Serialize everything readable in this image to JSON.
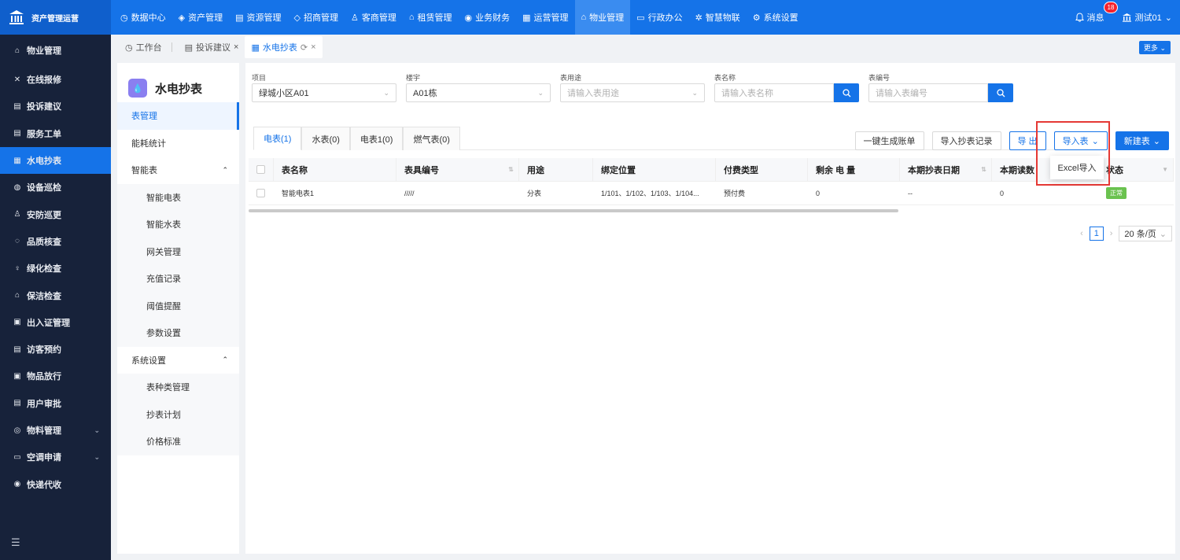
{
  "brand": {
    "name": "资产管理运营"
  },
  "topnav": [
    {
      "icon": "◷",
      "label": "数据中心"
    },
    {
      "icon": "◈",
      "label": "资产管理"
    },
    {
      "icon": "▤",
      "label": "资源管理"
    },
    {
      "icon": "◇",
      "label": "招商管理"
    },
    {
      "icon": "♙",
      "label": "客商管理"
    },
    {
      "icon": "⌂",
      "label": "租赁管理"
    },
    {
      "icon": "◉",
      "label": "业务财务"
    },
    {
      "icon": "▦",
      "label": "运营管理"
    },
    {
      "icon": "⌂",
      "label": "物业管理"
    },
    {
      "icon": "▭",
      "label": "行政办公"
    },
    {
      "icon": "✲",
      "label": "智慧物联"
    },
    {
      "icon": "⚙",
      "label": "系统设置"
    }
  ],
  "header": {
    "messages_label": "消息",
    "messages_count": "18",
    "user_name": "测试01"
  },
  "sidebar": {
    "items": [
      {
        "icon": "⌂",
        "label": "物业管理"
      },
      {
        "icon": "✕",
        "label": "在线报修"
      },
      {
        "icon": "▤",
        "label": "投诉建议"
      },
      {
        "icon": "▤",
        "label": "服务工单"
      },
      {
        "icon": "▦",
        "label": "水电抄表"
      },
      {
        "icon": "◍",
        "label": "设备巡检"
      },
      {
        "icon": "♙",
        "label": "安防巡更"
      },
      {
        "icon": "◌",
        "label": "品质核查"
      },
      {
        "icon": "♀",
        "label": "绿化检查"
      },
      {
        "icon": "⌂",
        "label": "保洁检查"
      },
      {
        "icon": "▣",
        "label": "出入证管理"
      },
      {
        "icon": "▤",
        "label": "访客预约"
      },
      {
        "icon": "▣",
        "label": "物品放行"
      },
      {
        "icon": "▤",
        "label": "用户审批"
      },
      {
        "icon": "◎",
        "label": "物料管理"
      },
      {
        "icon": "▭",
        "label": "空调申请"
      },
      {
        "icon": "◉",
        "label": "快递代收"
      }
    ],
    "collapse_icon": "☰"
  },
  "tabs": {
    "items": [
      {
        "icon": "◷",
        "label": "工作台"
      },
      {
        "icon": "▤",
        "label": "投诉建议",
        "close": "×"
      },
      {
        "icon": "▦",
        "label": "水电抄表",
        "refresh": "⟳",
        "close": "×"
      }
    ],
    "more": "更多"
  },
  "submenu": {
    "title": "水电抄表",
    "items": [
      {
        "label": "表管理"
      },
      {
        "label": "能耗统计"
      },
      {
        "label": "智能表"
      },
      {
        "label": "智能电表"
      },
      {
        "label": "智能水表"
      },
      {
        "label": "网关管理"
      },
      {
        "label": "充值记录"
      },
      {
        "label": "阈值提醒"
      },
      {
        "label": "参数设置"
      },
      {
        "label": "系统设置"
      },
      {
        "label": "表种类管理"
      },
      {
        "label": "抄表计划"
      },
      {
        "label": "价格标准"
      }
    ]
  },
  "filters": {
    "project": {
      "label": "项目",
      "value": "绿城小区A01"
    },
    "building": {
      "label": "楼宇",
      "value": "A01栋"
    },
    "usage": {
      "label": "表用途",
      "placeholder": "请输入表用途"
    },
    "meter_name": {
      "label": "表名称",
      "placeholder": "请输入表名称"
    },
    "meter_no": {
      "label": "表编号",
      "placeholder": "请输入表编号"
    }
  },
  "meter_tabs": [
    "电表(1)",
    "水表(0)",
    "电表1(0)",
    "燃气表(0)"
  ],
  "actions": {
    "generate_bill": "一键生成账单",
    "import_records": "导入抄表记录",
    "export": "导 出",
    "import_meter": "导入表",
    "new_meter": "新建表",
    "dropdown_excel": "Excel导入"
  },
  "table": {
    "headers": [
      "表名称",
      "表具编号",
      "用途",
      "绑定位置",
      "付费类型",
      "剩余 电 量",
      "本期抄表日期",
      "本期读数",
      "状态"
    ],
    "rows": [
      [
        "智能电表1",
        "/////",
        "分表",
        "1/101、1/102、1/103、1/104...",
        "预付费",
        "0",
        "--",
        "0",
        "正常"
      ]
    ]
  },
  "pagination": {
    "current": "1",
    "page_size": "20 条/页"
  }
}
